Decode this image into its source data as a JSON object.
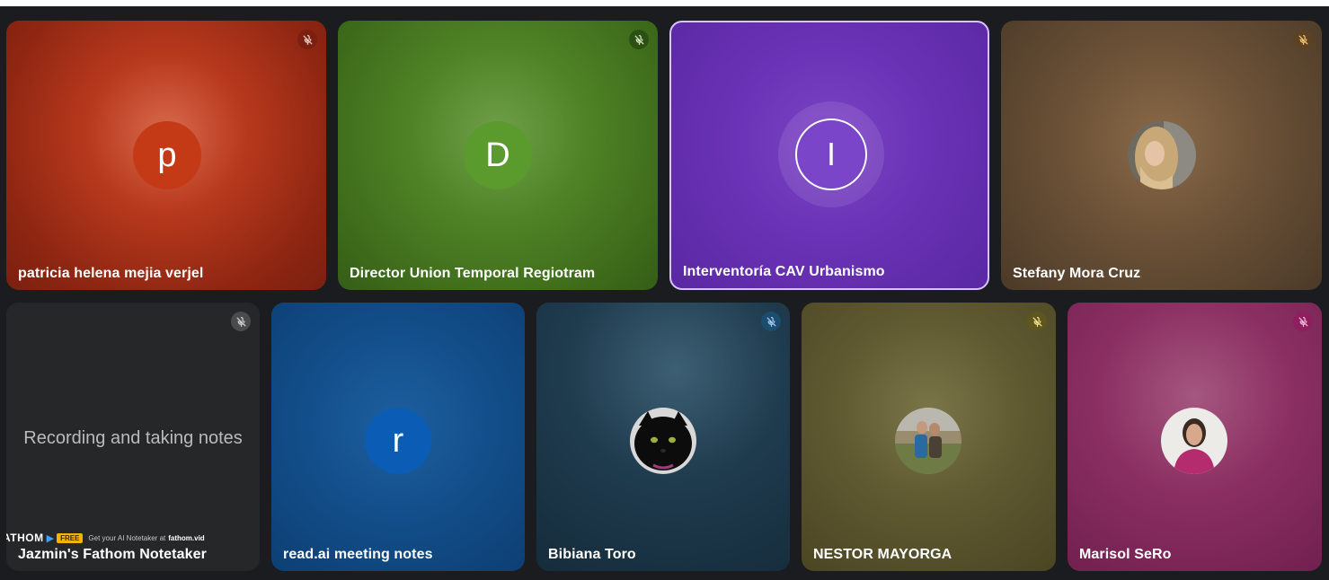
{
  "participants": [
    {
      "name": "patricia helena mejia verjel",
      "initial": "p",
      "avatar_color": "#c43a17",
      "mic": "muted",
      "mic_bg": "#7b1f10"
    },
    {
      "name": "Director Union Temporal Regiotram",
      "initial": "D",
      "avatar_color": "#5b9a2d",
      "mic": "muted",
      "mic_bg": "#2c4f13"
    },
    {
      "name": "Interventoría CAV Urbanismo",
      "initial": "I",
      "avatar_color": "#7a45c8",
      "mic": "speaking",
      "highlighted": true
    },
    {
      "name": "Stefany Mora Cruz",
      "avatar": "photo",
      "mic": "muted",
      "mic_bg": "#5a4222"
    },
    {
      "name": "Jazmin's Fathom Notetaker",
      "center_text": "Recording and taking notes",
      "mic": "muted",
      "mic_bg": "#4a4b4d"
    },
    {
      "name": "read.ai meeting notes",
      "initial": "r",
      "avatar_color": "#0b5cb5",
      "mic": "none"
    },
    {
      "name": "Bibiana Toro",
      "avatar": "photo",
      "mic": "muted",
      "mic_bg": "#1c4c6e"
    },
    {
      "name": "NESTOR MAYORGA",
      "avatar": "photo",
      "mic": "muted",
      "mic_bg": "#5e561e"
    },
    {
      "name": "Marisol SeRo",
      "avatar": "photo",
      "mic": "muted",
      "mic_bg": "#8d1f5e"
    }
  ],
  "fathom_banner": {
    "brand": "ATHOM",
    "badge": "FREE",
    "promo": "Get your AI Notetaker at",
    "url": "fathom.vid"
  },
  "icons": {
    "mic_muted": "mic-off-icon",
    "stream_arrow": "play-arrow-icon"
  }
}
